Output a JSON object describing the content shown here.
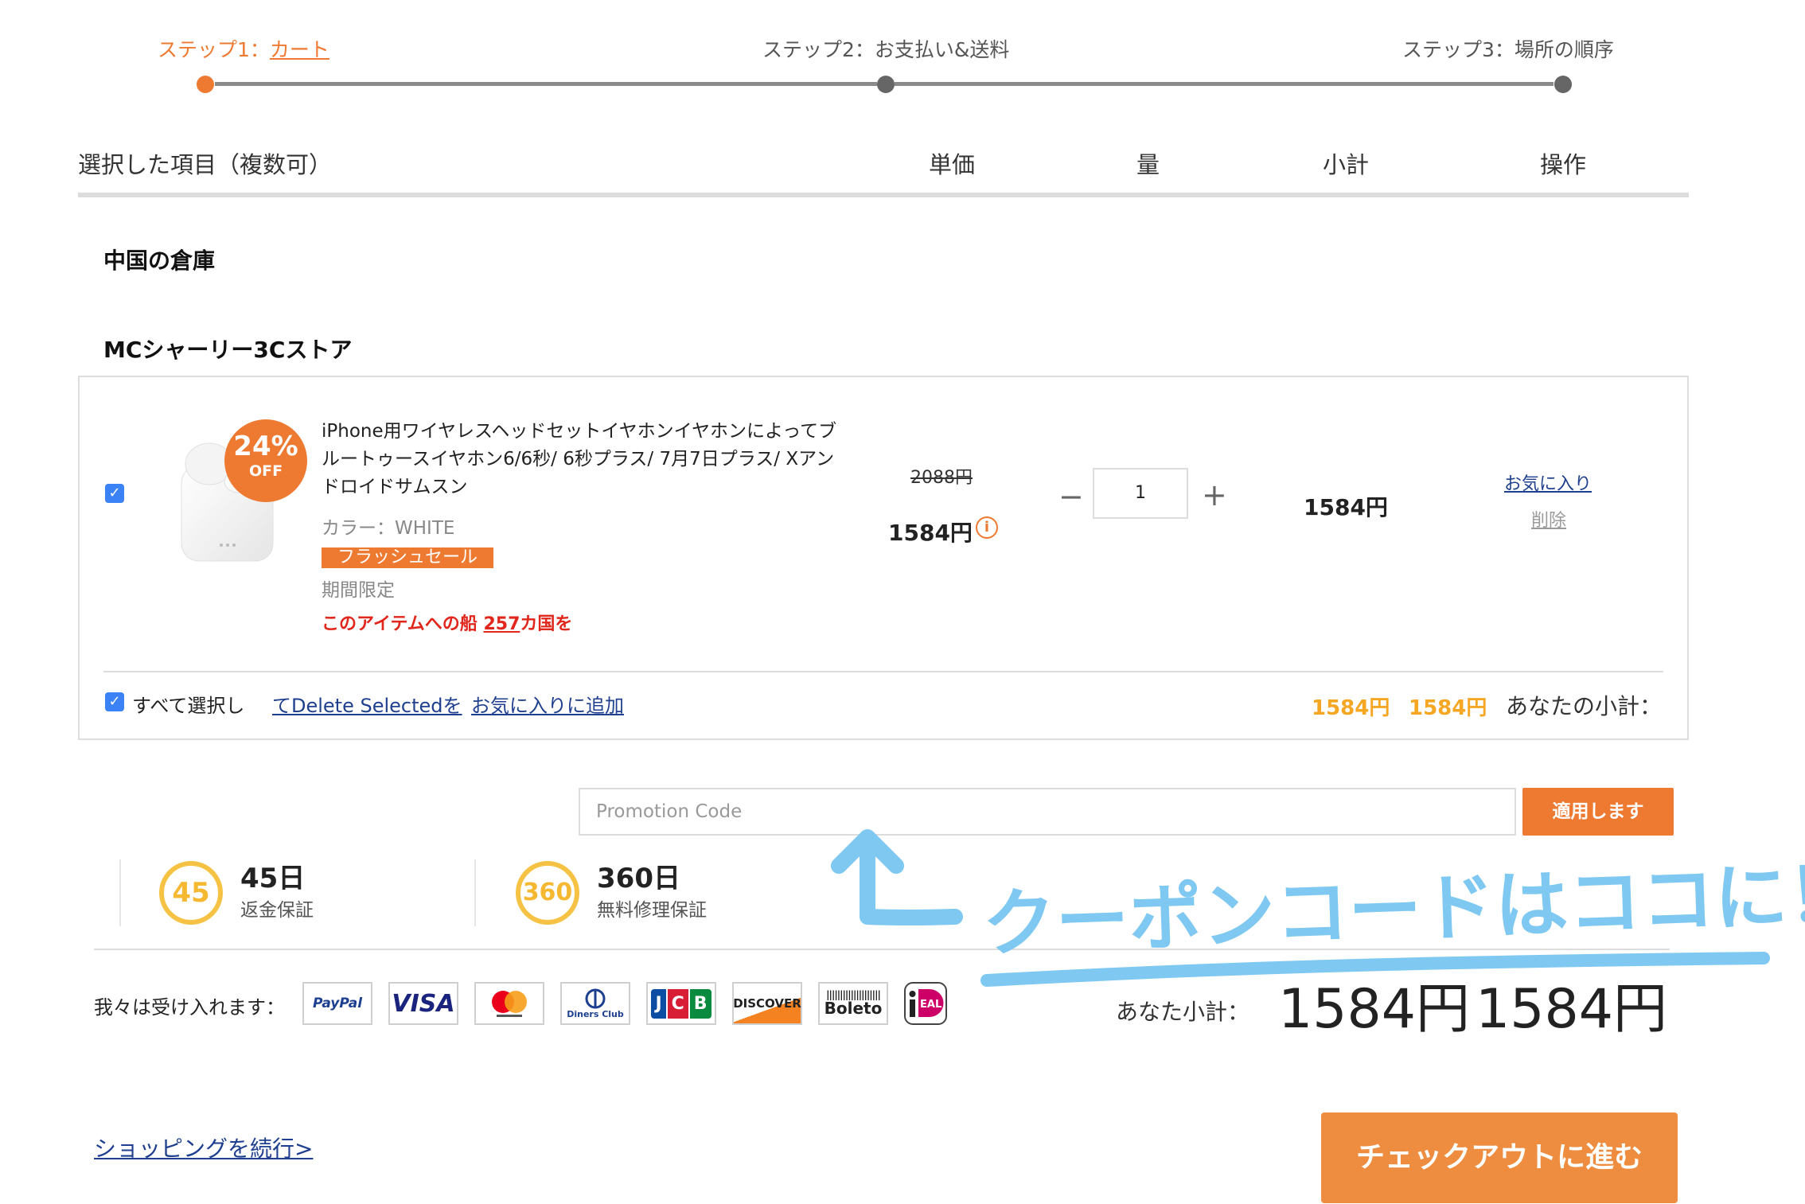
{
  "steps": [
    {
      "prefix": "ステップ1：",
      "link": "カート"
    },
    {
      "label": "ステップ2：お支払い&送料"
    },
    {
      "label": "ステップ3：場所の順序"
    }
  ],
  "table_headers": {
    "items": "選択した項目（複数可）",
    "unit_price": "単価",
    "quantity": "量",
    "subtotal": "小計",
    "operation": "操作"
  },
  "warehouse": "中国の倉庫",
  "store": "MCシャーリー3Cストア",
  "product": {
    "discount_pct": "24%",
    "discount_off": "OFF",
    "title": "iPhone用ワイヤレスヘッドセットイヤホンイヤホンによってブルートゥースイヤホン6/6秒/ 6秒プラス/ 7月7日プラス/ Xアンドロイドサムスン",
    "color": "カラー：WHITE",
    "flash_sale": "フラッシュセール",
    "limited": "期間限定",
    "ship_prefix": "このアイテムへの船",
    "ship_count": "257",
    "ship_suffix": "カ国を",
    "old_price": "2088円",
    "price": "1584円",
    "qty_minus": "−",
    "qty": "1",
    "qty_plus": "+",
    "subtotal": "1584円",
    "favorite": "お気に入り",
    "delete": "削除"
  },
  "footer_row": {
    "select_all": "すべて選択し",
    "delete_selected": "てDelete Selectedを",
    "add_favorites": "お気に入りに追加",
    "amount1": "1584円",
    "amount2": "1584円",
    "your_subtotal": "あなたの小計："
  },
  "promo": {
    "placeholder": "Promotion Code",
    "apply": "適用します"
  },
  "guarantees": [
    {
      "icon": "45",
      "big": "45日",
      "small": "返金保証"
    },
    {
      "icon": "360",
      "big": "360日",
      "small": "無料修理保証"
    }
  ],
  "accept_label": "我々は受け入れます：",
  "payments": [
    "PayPal",
    "VISA",
    "Mastercard",
    "Diners Club",
    "JCB",
    "DISCOVER",
    "Boleto",
    "iDEAL"
  ],
  "total": {
    "label": "あなた小計：",
    "amount1": "1584円",
    "amount2": "1584円"
  },
  "continue_shopping": "ショッピングを続行>",
  "checkout": "チェックアウトに進む",
  "annotation": "クーポンコードはココに！",
  "colors": {
    "accent": "#ee7a32",
    "link": "#1f3f8f",
    "annotation": "#7ec8f2"
  }
}
